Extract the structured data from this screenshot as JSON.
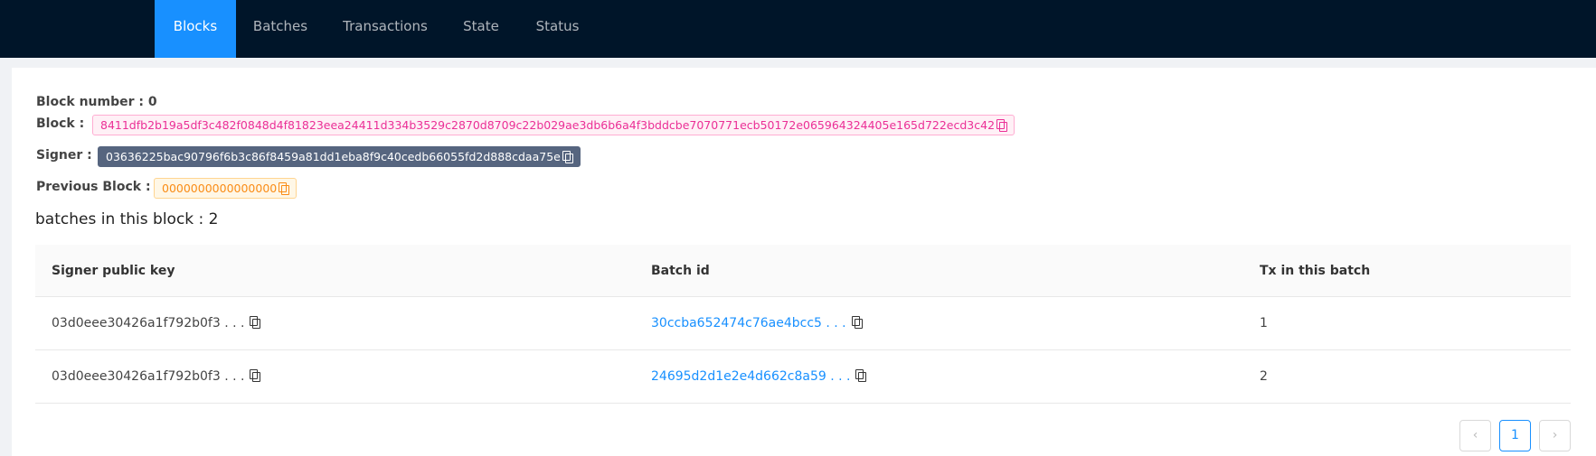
{
  "nav": {
    "items": [
      {
        "label": "Blocks",
        "active": true
      },
      {
        "label": "Batches",
        "active": false
      },
      {
        "label": "Transactions",
        "active": false
      },
      {
        "label": "State",
        "active": false
      },
      {
        "label": "Status",
        "active": false
      }
    ]
  },
  "block": {
    "number_label": "Block number : 0",
    "block_label": "Block :",
    "block_id": "8411dfb2b19a5df3c482f0848d4f81823eea24411d334b3529c2870d8709c22b029ae3db6b6a4f3bddcbe7070771ecb50172e065964324405e165d722ecd3c42",
    "signer_label": "Signer :",
    "signer": "03636225bac90796f6b3c86f8459a81dd1eba8f9c40cedb66055fd2d888cdaa75e",
    "previous_label": "Previous Block :",
    "previous": "0000000000000000"
  },
  "batches": {
    "title": "batches in this block : 2",
    "columns": [
      "Signer public key",
      "Batch id",
      "Tx in this batch"
    ],
    "rows": [
      {
        "signer": "03d0eee30426a1f792b0f3 . . .",
        "batch_id": "30ccba652474c76ae4bcc5 . . .",
        "tx": "1"
      },
      {
        "signer": "03d0eee30426a1f792b0f3 . . .",
        "batch_id": "24695d2d1e2e4d662c8a59 . . .",
        "tx": "2"
      }
    ]
  },
  "pagination": {
    "prev": "‹",
    "current": "1",
    "next": "›"
  },
  "colors": {
    "nav_bg": "#001529",
    "accent": "#1890ff",
    "tag_pink": "#eb2f96",
    "tag_slate": "#56657f",
    "tag_orange": "#fa8c16"
  }
}
